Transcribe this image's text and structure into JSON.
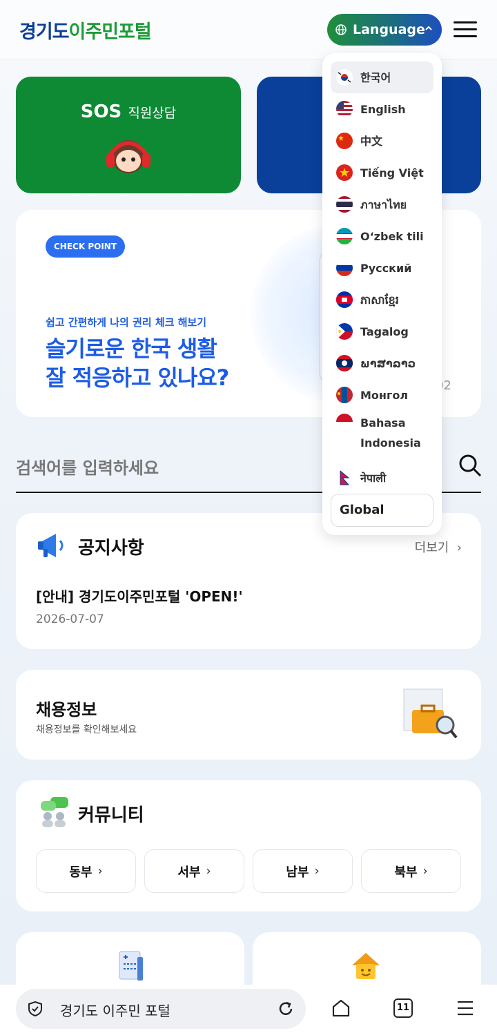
{
  "header": {
    "logo_part1": "경기도",
    "logo_part2": "이주민포털",
    "language_label": "Language"
  },
  "cards": {
    "sos_title": "SOS",
    "sos_subtitle": "직원상담"
  },
  "banner": {
    "badge": "CHECK POINT",
    "subtitle": "쉽고 간편하게 나의 권리 체크 해보기",
    "line1": "슬기로운 한국 생활",
    "line2": "잘 적응하고 있나요?",
    "page_indicator": "02"
  },
  "search": {
    "placeholder": "검색어를 입력하세요"
  },
  "notice": {
    "title": "공지사항",
    "more": "더보기",
    "item": "[안내] 경기도이주민포털 'OPEN!'",
    "date": "2026-07-07"
  },
  "jobs": {
    "title": "채용정보",
    "desc": "채용정보를 확인해보세요"
  },
  "community": {
    "title": "커뮤니티",
    "regions": [
      "동부",
      "서부",
      "남부",
      "북부"
    ]
  },
  "language_menu": {
    "items": [
      "한국어",
      "English",
      "中文",
      "Tiếng Việt",
      "ภาษาไทย",
      "O‘zbek tili",
      "Русский",
      "ភាសាខ្មែរ",
      "Tagalog",
      "ພາສາລາວ",
      "Монгол",
      "Bahasa Indonesia",
      "नेपाली"
    ],
    "global": "Global",
    "active": "한국어"
  },
  "browser": {
    "url": "경기도 이주민 포털",
    "tab_count": "11"
  },
  "colors": {
    "brand_green": "#0e8a35",
    "brand_blue": "#0a3f9a",
    "accent_blue": "#2b6ff0"
  }
}
